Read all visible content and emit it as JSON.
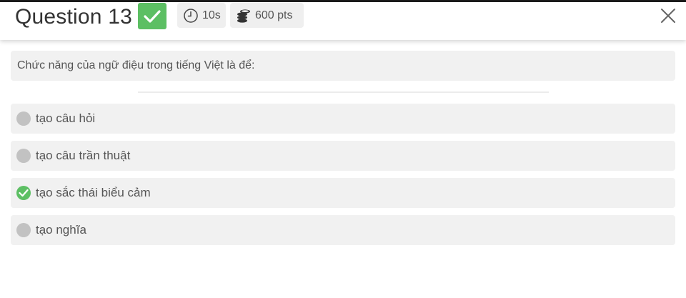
{
  "header": {
    "title": "Question 13",
    "status_icon": "check-icon",
    "timer": "10s",
    "points": "600 pts",
    "close_icon": "close-icon"
  },
  "question": {
    "text": "Chức năng của ngữ điệu trong tiếng Việt là để:"
  },
  "options": [
    {
      "label": "tạo câu hỏi",
      "correct": false
    },
    {
      "label": "tạo câu trần thuật",
      "correct": false
    },
    {
      "label": "tạo sắc thái biểu cảm",
      "correct": true
    },
    {
      "label": "tạo nghĩa",
      "correct": false
    }
  ],
  "colors": {
    "correct_green": "#5cbf63",
    "option_bg": "#f1f1f1",
    "radio_gray": "#c2c2c2",
    "text": "#555555"
  }
}
